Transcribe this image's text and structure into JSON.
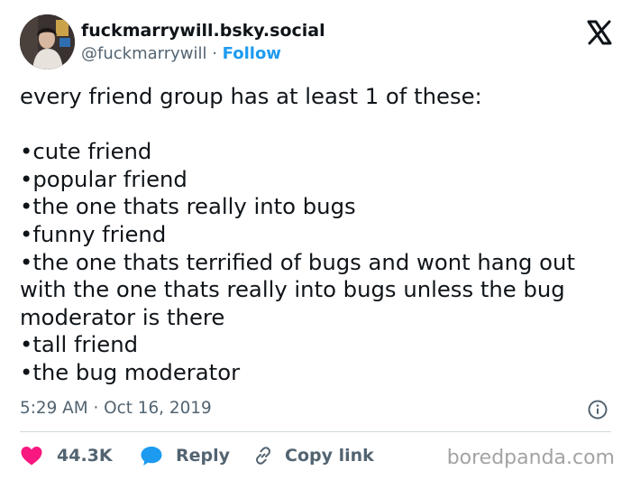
{
  "author": {
    "display_name": "fuckmarrywill.bsky.social",
    "handle": "@fuckmarrywill",
    "separator": " · ",
    "follow_label": "Follow"
  },
  "post": {
    "text": "every friend group has at least 1 of these:\n\n•cute friend\n•popular friend\n•the one thats really into bugs\n•funny friend\n•the one thats terrified of bugs and wont hang out with the one thats really into bugs unless the bug moderator is there\n•tall friend\n•the bug moderator",
    "timestamp": "5:29 AM · Oct 16, 2019"
  },
  "actions": {
    "like_count": "44.3K",
    "reply_label": "Reply",
    "copy_label": "Copy link"
  },
  "watermark": "boredpanda.com",
  "icons": {
    "avatar": "profile-photo",
    "brand": "x-logo-icon",
    "info": "info-icon",
    "like": "heart-icon",
    "reply": "speech-bubble-icon",
    "copy": "link-icon"
  },
  "colors": {
    "text": "#0f1419",
    "secondary": "#536471",
    "link": "#1d9bf0",
    "like": "#f91880",
    "divider": "#cfd9de",
    "watermark": "#a3a3a3"
  }
}
